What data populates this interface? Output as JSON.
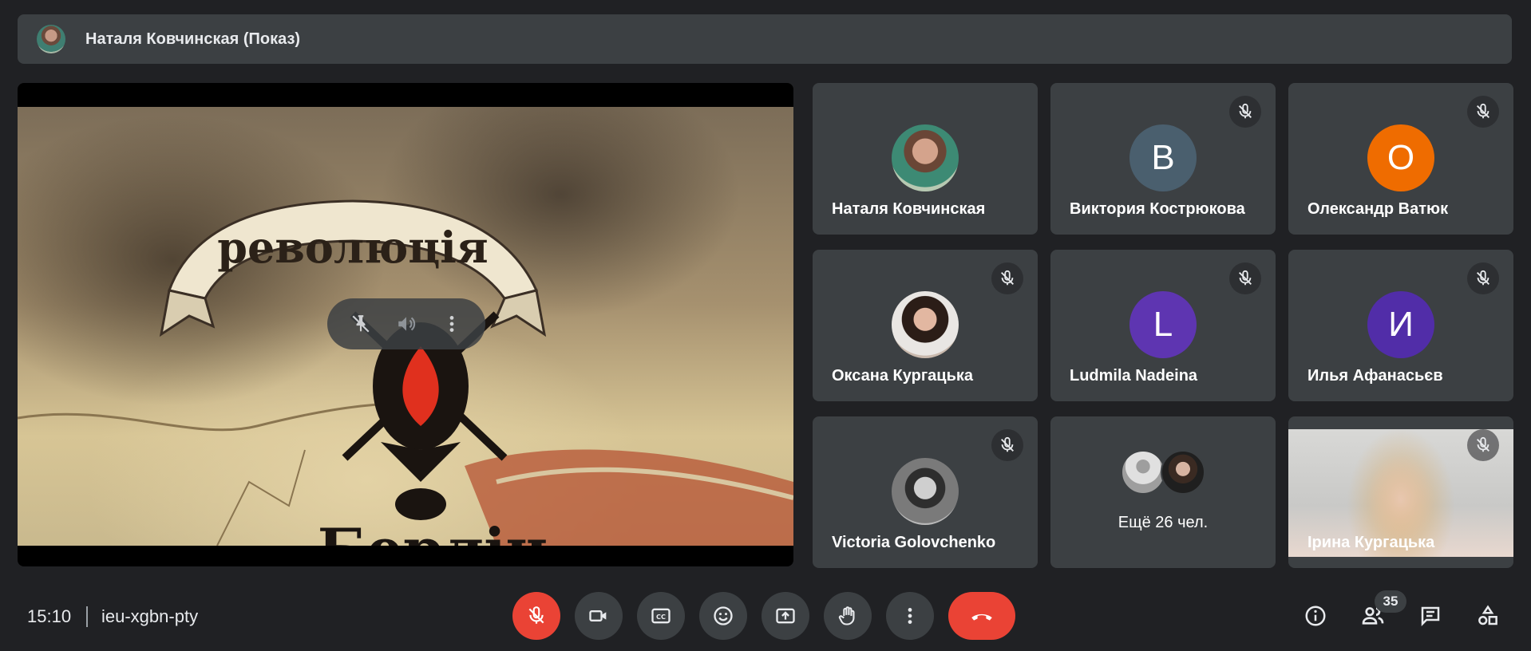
{
  "presenter": {
    "name": "Наталя Ковчинская (Показ)"
  },
  "video": {
    "title_top": "революція",
    "title_bottom": "Берлін"
  },
  "participants": [
    {
      "name": "Наталя Ковчинская",
      "initial": "",
      "color": "",
      "muted": false
    },
    {
      "name": "Виктория Кострюкова",
      "initial": "В",
      "color": "#4a5f6e",
      "muted": true
    },
    {
      "name": "Олександр Ватюк",
      "initial": "О",
      "color": "#ef6c00",
      "muted": true
    },
    {
      "name": "Оксана Кургацька",
      "initial": "",
      "color": "",
      "muted": true
    },
    {
      "name": "Ludmila Nadeina",
      "initial": "L",
      "color": "#5e35b1",
      "muted": true
    },
    {
      "name": "Илья Афанасьєв",
      "initial": "И",
      "color": "#512da8",
      "muted": true
    },
    {
      "name": "Victoria Golovchenko",
      "initial": "",
      "color": "",
      "muted": true
    },
    {
      "name": "Ірина Кургацька",
      "initial": "",
      "color": "",
      "muted": true
    }
  ],
  "more": {
    "label": "Ещё 26 чел."
  },
  "bottom": {
    "time": "15:10",
    "meeting_code": "ieu-xgbn-pty",
    "participant_count": "35"
  },
  "controls": [
    "mic-off",
    "camera",
    "captions",
    "emoji",
    "present",
    "raise-hand",
    "more",
    "end-call"
  ],
  "right_controls": [
    "info",
    "people",
    "chat",
    "activities"
  ],
  "colors": {
    "background": "#202124",
    "tile": "#3c4043",
    "danger": "#ea4335"
  }
}
